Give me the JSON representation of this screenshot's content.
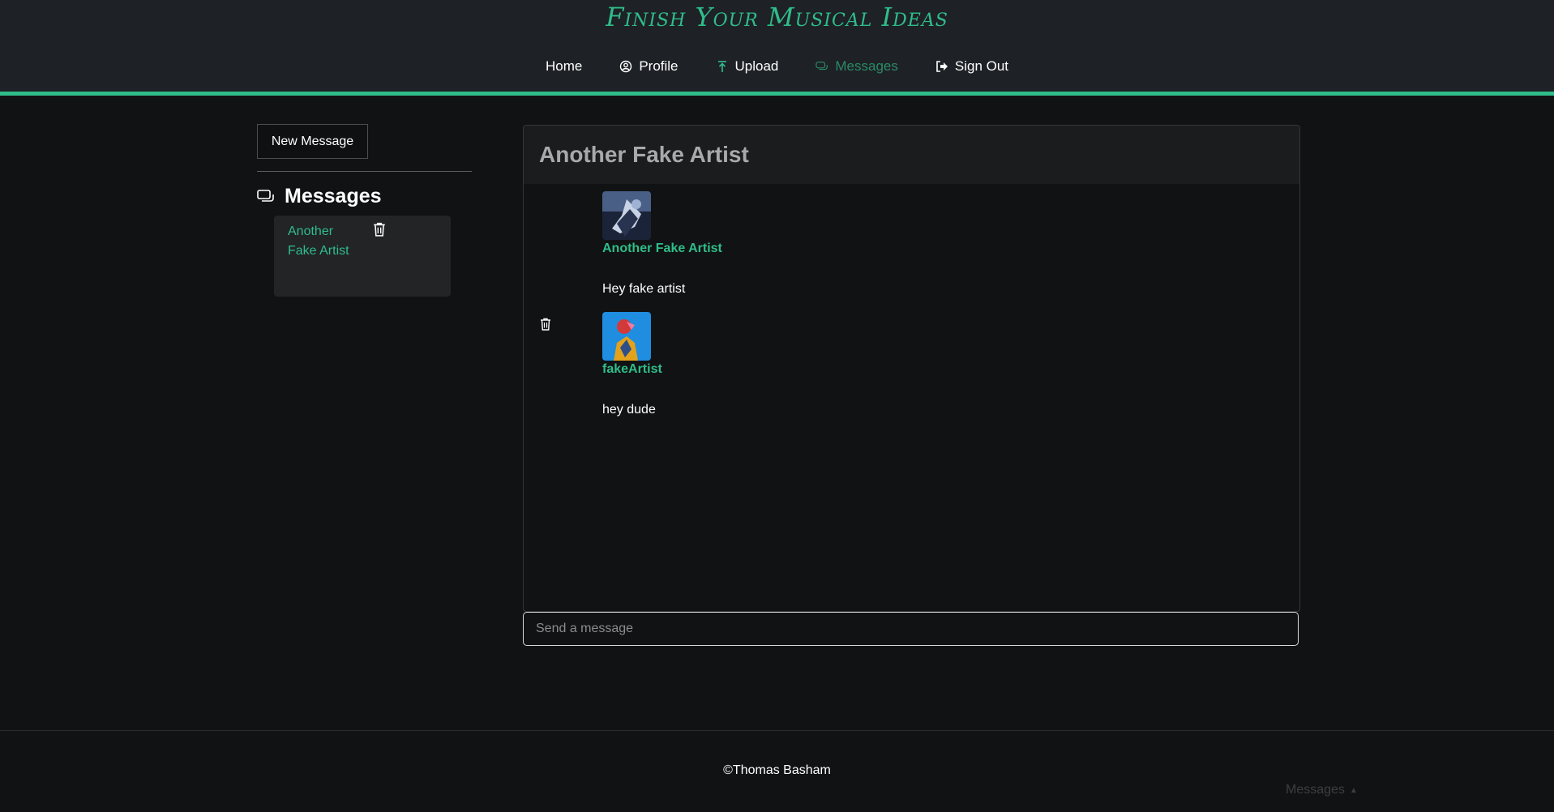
{
  "brand": "Finish Your Musical Ideas",
  "nav": [
    {
      "label": "Home",
      "icon": "none"
    },
    {
      "label": "Profile",
      "icon": "user-circle-icon"
    },
    {
      "label": "Upload",
      "icon": "upload-icon"
    },
    {
      "label": "Messages",
      "icon": "chat-bubbles-icon",
      "active": true
    },
    {
      "label": "Sign Out",
      "icon": "sign-out-icon"
    }
  ],
  "sidebar": {
    "new_message_label": "New Message",
    "title": "Messages",
    "conversations": [
      {
        "name": "Another Fake Artist"
      }
    ]
  },
  "chat": {
    "title": "Another Fake Artist",
    "messages": [
      {
        "sender": "Another Fake Artist",
        "text": "Hey fake artist",
        "deletable": false
      },
      {
        "sender": "fakeArtist",
        "text": "hey dude",
        "deletable": true
      }
    ],
    "input_placeholder": "Send a message"
  },
  "footer": {
    "copyright": "©Thomas Basham",
    "dock_label": "Messages"
  },
  "colors": {
    "accent": "#2fbd8a",
    "header_bg": "#1e2126",
    "page_bg": "#111213"
  }
}
